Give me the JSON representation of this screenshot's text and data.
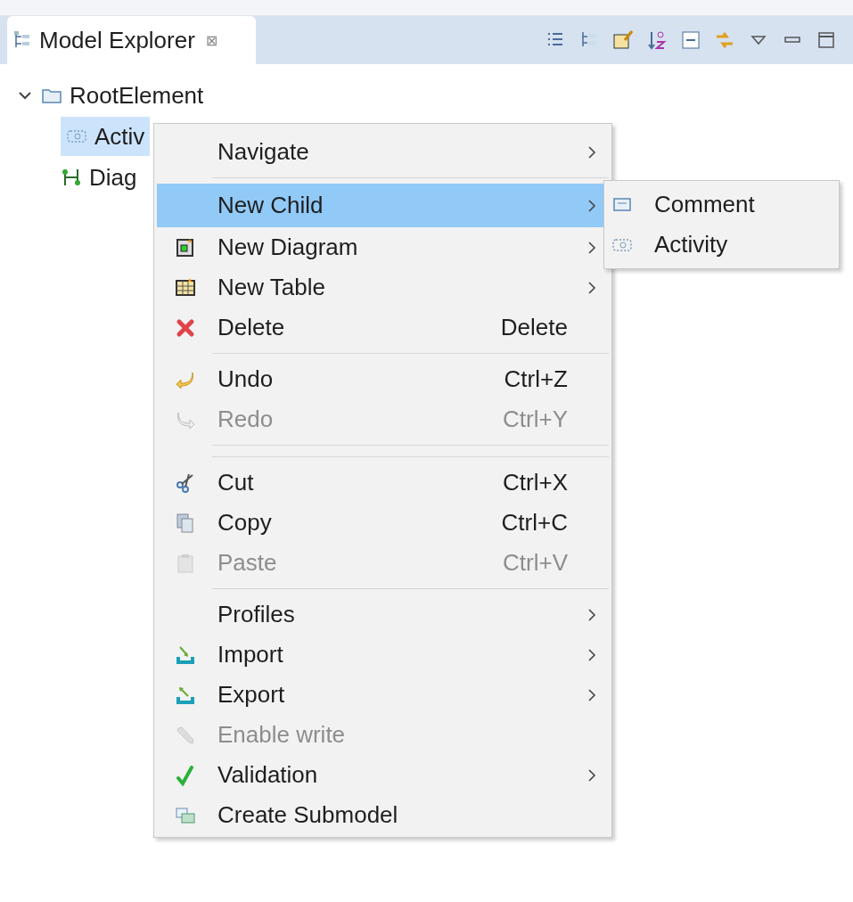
{
  "view": {
    "title": "Model Explorer",
    "close": "⊠"
  },
  "tree": [
    {
      "label": "RootElement",
      "expanded": true,
      "selected": false,
      "children": [
        {
          "label": "Activ",
          "selected": true
        },
        {
          "label": "Diag",
          "selected": false
        }
      ]
    }
  ],
  "context_menu": {
    "items": [
      {
        "kind": "item",
        "label": "Navigate",
        "submenu": true,
        "disabled": false,
        "selected": false
      },
      {
        "kind": "separator"
      },
      {
        "kind": "item",
        "label": "New Child",
        "submenu": true,
        "disabled": false,
        "selected": true
      },
      {
        "kind": "item",
        "label": "New Diagram",
        "submenu": true,
        "disabled": false,
        "selected": false
      },
      {
        "kind": "item",
        "label": "New Table",
        "submenu": true,
        "disabled": false,
        "selected": false
      },
      {
        "kind": "item",
        "label": "Delete",
        "shortcut": "Delete",
        "submenu": false,
        "disabled": false,
        "selected": false
      },
      {
        "kind": "separator"
      },
      {
        "kind": "item",
        "label": "Undo",
        "shortcut": "Ctrl+Z",
        "submenu": false,
        "disabled": false,
        "selected": false
      },
      {
        "kind": "item",
        "label": "Redo",
        "shortcut": "Ctrl+Y",
        "submenu": false,
        "disabled": true,
        "selected": false
      },
      {
        "kind": "separator"
      },
      {
        "kind": "separator"
      },
      {
        "kind": "item",
        "label": "Cut",
        "shortcut": "Ctrl+X",
        "submenu": false,
        "disabled": false,
        "selected": false
      },
      {
        "kind": "item",
        "label": "Copy",
        "shortcut": "Ctrl+C",
        "submenu": false,
        "disabled": false,
        "selected": false
      },
      {
        "kind": "item",
        "label": "Paste",
        "shortcut": "Ctrl+V",
        "submenu": false,
        "disabled": true,
        "selected": false
      },
      {
        "kind": "separator"
      },
      {
        "kind": "item",
        "label": "Profiles",
        "submenu": true,
        "disabled": false,
        "selected": false
      },
      {
        "kind": "item",
        "label": "Import",
        "submenu": true,
        "disabled": false,
        "selected": false
      },
      {
        "kind": "item",
        "label": "Export",
        "submenu": true,
        "disabled": false,
        "selected": false
      },
      {
        "kind": "item",
        "label": "Enable write",
        "submenu": false,
        "disabled": true,
        "selected": false
      },
      {
        "kind": "item",
        "label": "Validation",
        "submenu": true,
        "disabled": false,
        "selected": false
      },
      {
        "kind": "item",
        "label": "Create Submodel",
        "submenu": false,
        "disabled": false,
        "selected": false
      }
    ]
  },
  "submenu": {
    "items": [
      {
        "label": "Comment"
      },
      {
        "label": "Activity"
      }
    ]
  }
}
